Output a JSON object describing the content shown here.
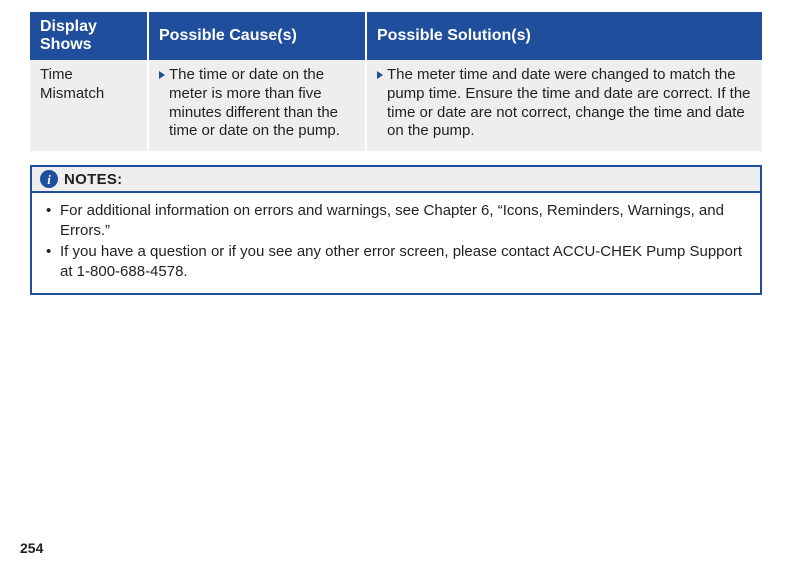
{
  "table": {
    "headers": {
      "display": "Display Shows",
      "cause": "Possible Cause(s)",
      "solution": "Possible Solution(s)"
    },
    "row": {
      "display": "Time Mismatch",
      "cause": "The time or date on the meter is more than five minutes different than the time or date on the pump.",
      "solution": "The meter time and date were changed to match the pump time. Ensure the time and date are correct. If the time or date are not correct, change the time and date on the pump."
    }
  },
  "notes": {
    "label": "NOTES:",
    "info_glyph": "i",
    "items": [
      "For additional information on errors and warnings, see Chapter 6, “Icons, Reminders, Warnings, and Errors.”",
      "If you have a question or if you see any other error screen, please contact ACCU-CHEK Pump Support at 1-800-688-4578."
    ]
  },
  "page_number": "254"
}
